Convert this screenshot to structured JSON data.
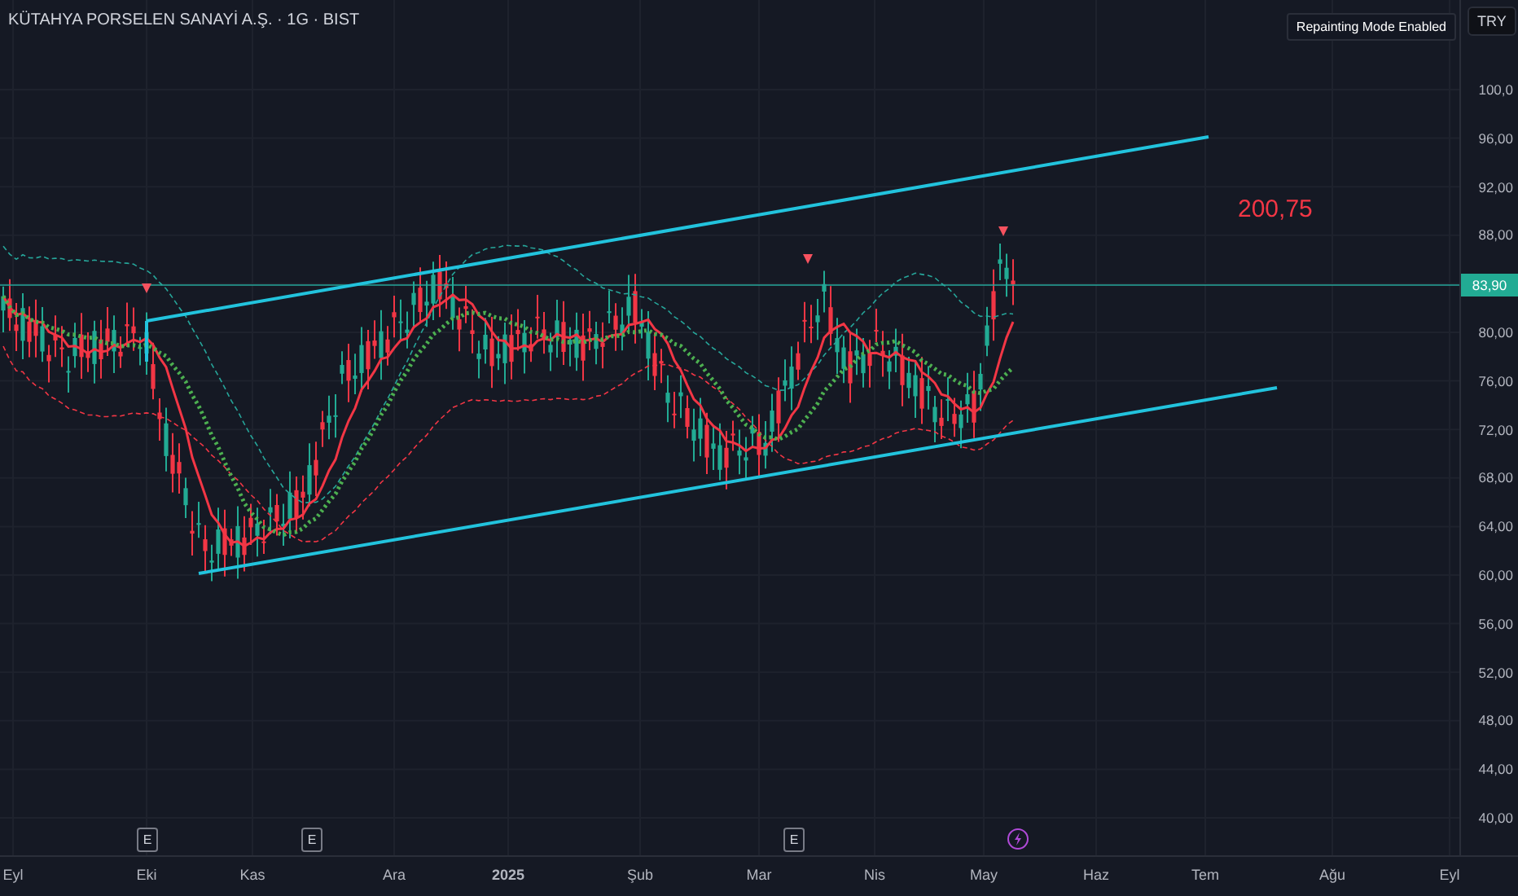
{
  "header": {
    "title": "KÜTAHYA PORSELEN SANAYİ A.Ş. · 1G · BIST",
    "badge": "Repainting Mode Enabled",
    "currency": "TRY"
  },
  "chart": {
    "annotation": "200,75",
    "current_price": "83,90",
    "price_axis": [
      "100,0",
      "96,00",
      "92,00",
      "88,00",
      "80,00",
      "76,00",
      "72,00",
      "68,00",
      "64,00",
      "60,00",
      "56,00",
      "52,00",
      "48,00",
      "44,00",
      "40,00"
    ],
    "events": [
      {
        "kind": "earnings",
        "label": "E"
      },
      {
        "kind": "earnings",
        "label": "E"
      },
      {
        "kind": "earnings",
        "label": "E"
      },
      {
        "kind": "split"
      }
    ]
  },
  "time_axis": [
    {
      "label": "Eyl",
      "kind": "month"
    },
    {
      "label": "Eki",
      "kind": "month"
    },
    {
      "label": "Kas",
      "kind": "month"
    },
    {
      "label": "Ara",
      "kind": "month"
    },
    {
      "label": "2025",
      "kind": "year"
    },
    {
      "label": "Şub",
      "kind": "month"
    },
    {
      "label": "Mar",
      "kind": "month"
    },
    {
      "label": "Nis",
      "kind": "month"
    },
    {
      "label": "May",
      "kind": "month"
    },
    {
      "label": "Haz",
      "kind": "month"
    },
    {
      "label": "Tem",
      "kind": "month"
    },
    {
      "label": "Ağu",
      "kind": "month"
    },
    {
      "label": "Eyl",
      "kind": "month"
    }
  ]
}
